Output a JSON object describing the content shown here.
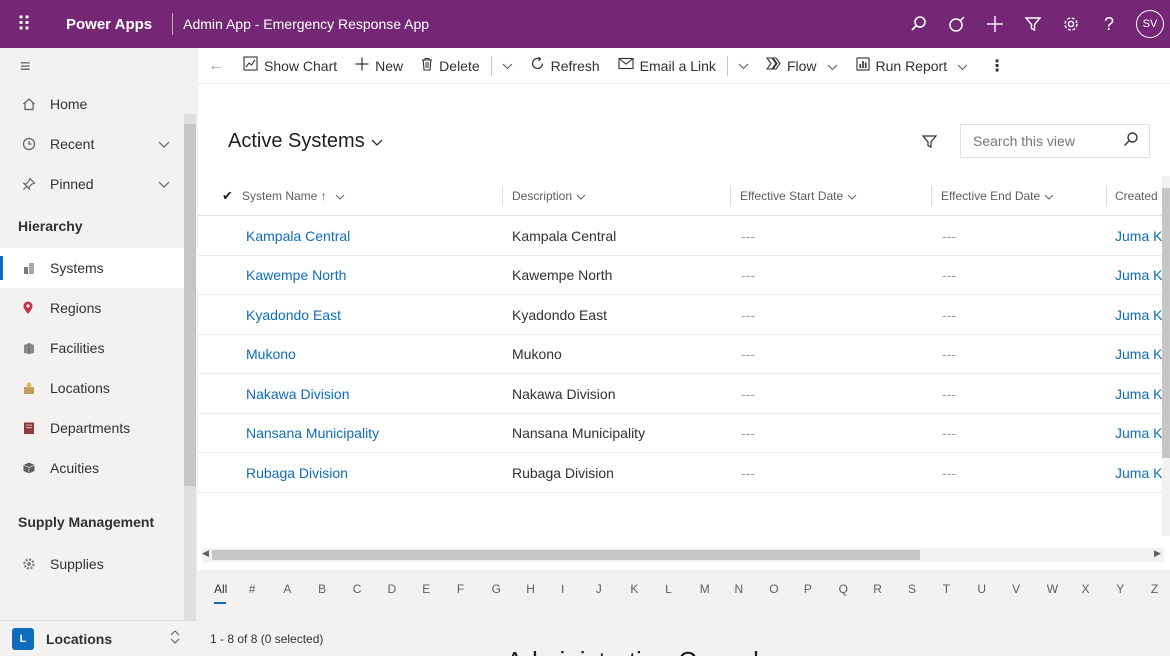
{
  "topbar": {
    "waffle_glyph": "⠿",
    "brand": "Power Apps",
    "app_title": "Admin App - Emergency Response App",
    "icons": [
      "search-icon",
      "assistant-icon",
      "add-icon",
      "filter-icon",
      "settings-icon",
      "help-icon"
    ],
    "avatar_initials": "SV",
    "background": "#742774"
  },
  "sidebar": {
    "nav": [
      {
        "label": "Home",
        "icon": "home-icon"
      },
      {
        "label": "Recent",
        "icon": "clock-icon",
        "expandable": true
      },
      {
        "label": "Pinned",
        "icon": "pin-icon",
        "expandable": true
      }
    ],
    "groups": [
      {
        "title": "Hierarchy",
        "items": [
          {
            "label": "Systems",
            "icon": "systems-icon",
            "selected": true
          },
          {
            "label": "Regions",
            "icon": "map-pin-icon"
          },
          {
            "label": "Facilities",
            "icon": "facility-icon"
          },
          {
            "label": "Locations",
            "icon": "location-icon"
          },
          {
            "label": "Departments",
            "icon": "department-icon"
          },
          {
            "label": "Acuities",
            "icon": "acuity-icon"
          }
        ]
      },
      {
        "title": "Supply Management",
        "items": [
          {
            "label": "Supplies",
            "icon": "gear-icon"
          }
        ]
      }
    ],
    "area_switcher": {
      "badge": "L",
      "label": "Locations"
    }
  },
  "commandbar": {
    "show_chart": "Show Chart",
    "new": "New",
    "delete": "Delete",
    "refresh": "Refresh",
    "email_link": "Email a Link",
    "flow": "Flow",
    "run_report": "Run Report"
  },
  "view": {
    "title": "Active Systems",
    "search_placeholder": "Search this view"
  },
  "grid": {
    "columns": [
      {
        "label": "System Name ↑"
      },
      {
        "label": "Description"
      },
      {
        "label": "Effective Start Date"
      },
      {
        "label": "Effective End Date"
      },
      {
        "label": "Created B"
      }
    ],
    "rows": [
      {
        "name": "Kampala Central",
        "description": "Kampala Central",
        "start": "---",
        "end": "---",
        "created_by": "Juma Kis"
      },
      {
        "name": "Kawempe North",
        "description": "Kawempe North",
        "start": "---",
        "end": "---",
        "created_by": "Juma Kis"
      },
      {
        "name": "Kyadondo East",
        "description": "Kyadondo East",
        "start": "---",
        "end": "---",
        "created_by": "Juma Kis"
      },
      {
        "name": "Mukono",
        "description": "Mukono",
        "start": "---",
        "end": "---",
        "created_by": "Juma Kis"
      },
      {
        "name": "Nakawa Division",
        "description": "Nakawa Division",
        "start": "---",
        "end": "---",
        "created_by": "Juma Kis"
      },
      {
        "name": "Nansana Municipality",
        "description": "Nansana Municipality",
        "start": "---",
        "end": "---",
        "created_by": "Juma Kis"
      },
      {
        "name": "Rubaga Division",
        "description": "Rubaga Division",
        "start": "---",
        "end": "---",
        "created_by": "Juma Kis"
      }
    ]
  },
  "jumpbar": {
    "letters": [
      "All",
      "#",
      "A",
      "B",
      "C",
      "D",
      "E",
      "F",
      "G",
      "H",
      "I",
      "J",
      "K",
      "L",
      "M",
      "N",
      "O",
      "P",
      "Q",
      "R",
      "S",
      "T",
      "U",
      "V",
      "W",
      "X",
      "Y",
      "Z"
    ],
    "active": "All"
  },
  "status": {
    "record_count": "1 - 8 of 8 (0 selected)"
  },
  "overlay_caption": "Administration Console",
  "colors": {
    "accent": "#742774",
    "link": "#0f6cbd",
    "selection_bar": "#0f6cbd"
  }
}
